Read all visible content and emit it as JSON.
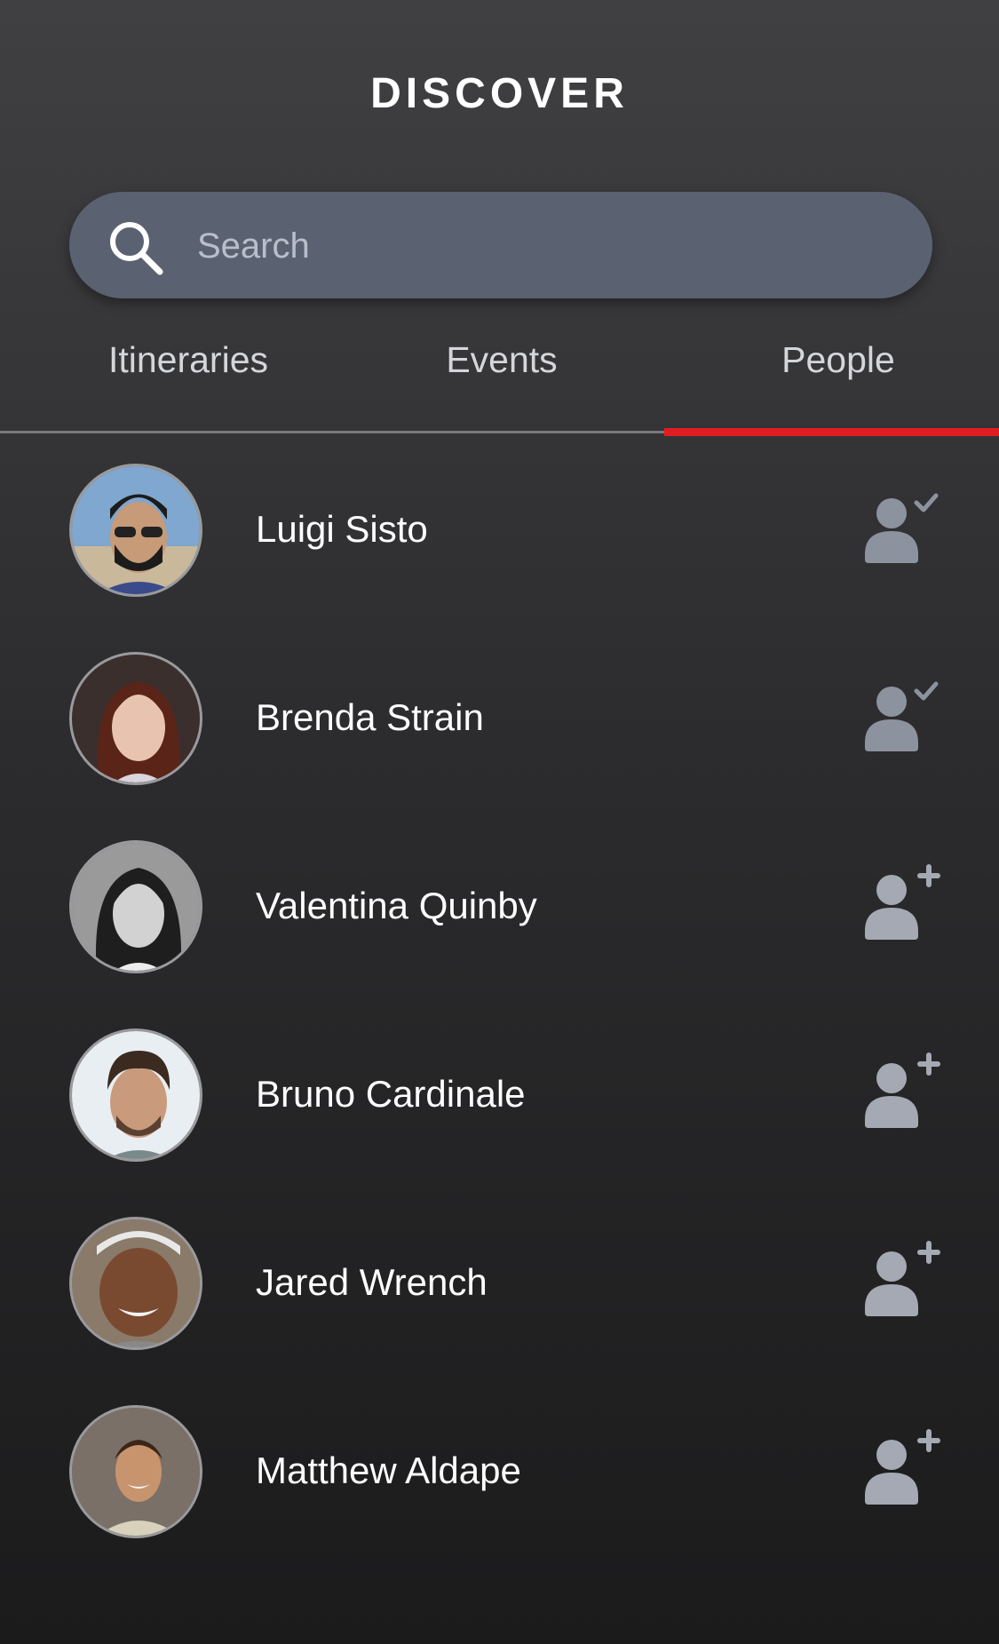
{
  "header": {
    "title": "DISCOVER"
  },
  "search": {
    "placeholder": "Search",
    "value": ""
  },
  "tabs": [
    {
      "label": "Itineraries",
      "active": false
    },
    {
      "label": "Events",
      "active": false
    },
    {
      "label": "People",
      "active": true
    }
  ],
  "colors": {
    "accent": "#e01e22",
    "search_bg": "#5a6272",
    "icon_gray": "#8c929e"
  },
  "people": [
    {
      "name": "Luigi Sisto",
      "action_icon": "user-check-icon",
      "status": "friend"
    },
    {
      "name": "Brenda Strain",
      "action_icon": "user-check-icon",
      "status": "friend"
    },
    {
      "name": "Valentina Quinby",
      "action_icon": "user-add-icon",
      "status": "not-friend"
    },
    {
      "name": "Bruno Cardinale",
      "action_icon": "user-add-icon",
      "status": "not-friend"
    },
    {
      "name": "Jared Wrench",
      "action_icon": "user-add-icon",
      "status": "not-friend"
    },
    {
      "name": "Matthew Aldape",
      "action_icon": "user-add-icon",
      "status": "not-friend"
    }
  ]
}
